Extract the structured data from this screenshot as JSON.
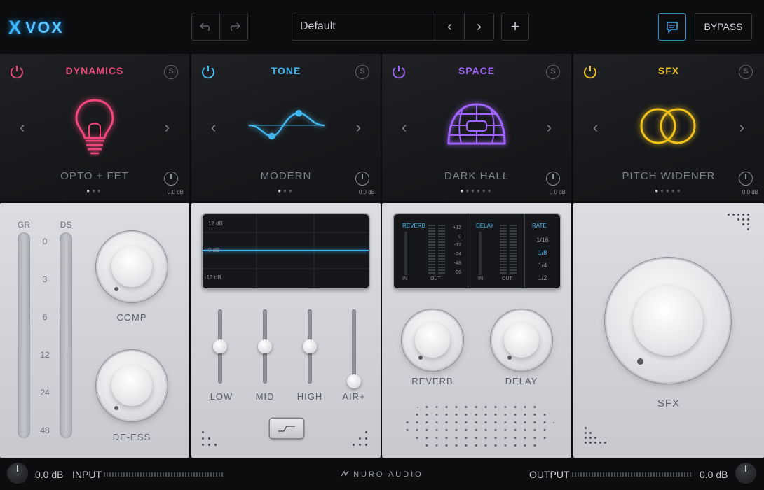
{
  "header": {
    "logo_glyph": "X",
    "logo_text": "VOX",
    "undo_icon": "undo-icon",
    "redo_icon": "redo-icon",
    "preset_name": "Default",
    "prev_glyph": "‹",
    "next_glyph": "›",
    "add_glyph": "+",
    "bypass_label": "BYPASS"
  },
  "modules": [
    {
      "title": "DYNAMICS",
      "color": "#f0467a",
      "preset": "OPTO + FET",
      "db": "0.0 dB",
      "page_index": 1,
      "page_count": 3
    },
    {
      "title": "TONE",
      "color": "#43b8ef",
      "preset": "MODERN",
      "db": "0.0 dB",
      "page_index": 1,
      "page_count": 3
    },
    {
      "title": "SPACE",
      "color": "#9f63ff",
      "preset": "DARK HALL",
      "db": "0.0 dB",
      "page_index": 1,
      "page_count": 6
    },
    {
      "title": "SFX",
      "color": "#f1c21b",
      "preset": "PITCH WIDENER",
      "db": "0.0 dB",
      "page_index": 1,
      "page_count": 5
    }
  ],
  "dynamics": {
    "gr_label": "GR",
    "ds_label": "DS",
    "scale": [
      "0",
      "3",
      "6",
      "12",
      "24",
      "48"
    ],
    "comp_label": "COMP",
    "deess_label": "DE-ESS"
  },
  "tone": {
    "eq_labels": [
      "12 dB",
      "0 dB",
      "-12 dB"
    ],
    "faders": [
      {
        "label": "LOW",
        "level": 0.5
      },
      {
        "label": "MID",
        "level": 0.5
      },
      {
        "label": "HIGH",
        "level": 0.5
      },
      {
        "label": "AIR+",
        "level": 0.0
      }
    ]
  },
  "space": {
    "reverb_title": "REVERB",
    "delay_title": "DELAY",
    "rate_title": "RATE",
    "scale": [
      "+12",
      "0",
      "-12",
      "-24",
      "-48",
      "-96"
    ],
    "in_label": "IN",
    "out_label": "OUT",
    "rates": [
      "1/16",
      "1/8",
      "1/4",
      "1/2"
    ],
    "selected_rate": "1/8",
    "reverb_label": "REVERB",
    "delay_label": "DELAY"
  },
  "sfx": {
    "label": "SFX"
  },
  "footer": {
    "input_db": "0.0 dB",
    "input_label": "INPUT",
    "brand": "NURO AUDIO",
    "output_label": "OUTPUT",
    "output_db": "0.0 dB"
  }
}
